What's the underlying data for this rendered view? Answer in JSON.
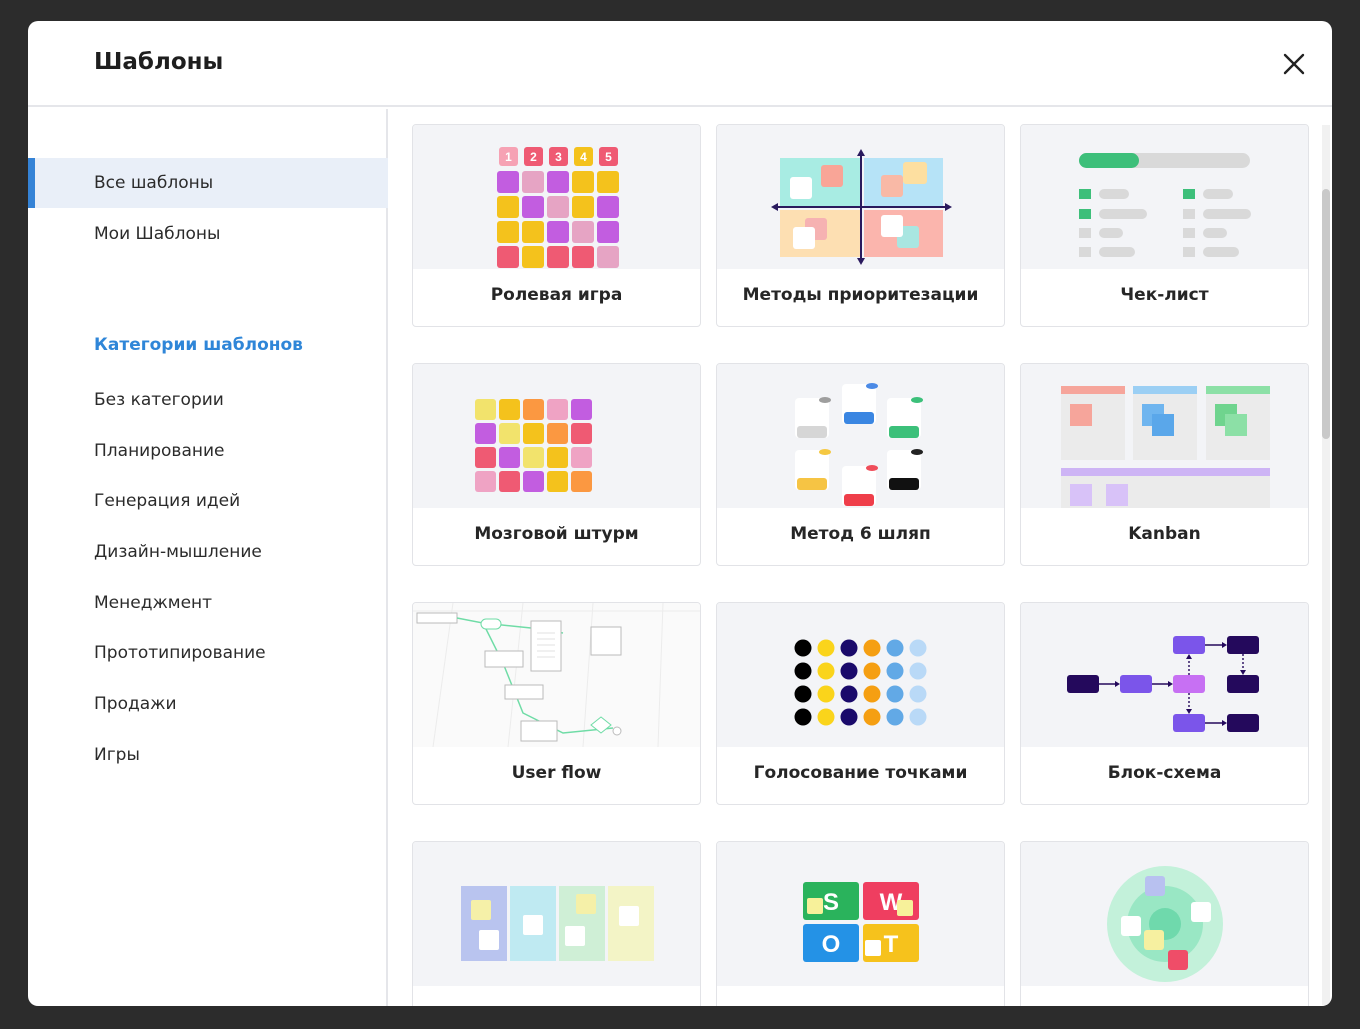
{
  "header": {
    "title": "Шаблоны"
  },
  "sidebar": {
    "items": [
      "Все шаблоны",
      "Мои Шаблоны"
    ],
    "categories_title": "Категории шаблонов",
    "categories": [
      "Без категории",
      "Планирование",
      "Генерация идей",
      "Дизайн-мышление",
      "Менеджмент",
      "Прототипирование",
      "Продажи",
      "Игры"
    ]
  },
  "cards": [
    {
      "label": "Ролевая игра",
      "icon": "role-play-thumbnail"
    },
    {
      "label": "Методы приоритезации",
      "icon": "prioritization-thumbnail"
    },
    {
      "label": "Чек-лист",
      "icon": "checklist-thumbnail"
    },
    {
      "label": "Мозговой штурм",
      "icon": "brainstorm-thumbnail"
    },
    {
      "label": "Метод 6 шляп",
      "icon": "six-hats-thumbnail"
    },
    {
      "label": "Kanban",
      "icon": "kanban-thumbnail"
    },
    {
      "label": "User flow",
      "icon": "user-flow-thumbnail"
    },
    {
      "label": "Голосование точками",
      "icon": "dot-voting-thumbnail"
    },
    {
      "label": "Блок-схема",
      "icon": "flowchart-thumbnail"
    },
    {
      "label": "",
      "icon": "retro-thumbnail"
    },
    {
      "label": "",
      "icon": "swot-thumbnail"
    },
    {
      "label": "",
      "icon": "circles-thumbnail"
    }
  ],
  "thumb_texts": {
    "role_numbers": [
      "1",
      "2",
      "3",
      "4",
      "5"
    ],
    "swot_letters": [
      "S",
      "W",
      "O",
      "T"
    ]
  },
  "colors": {
    "accent": "#3583d6",
    "category_title": "#2f86d8"
  }
}
